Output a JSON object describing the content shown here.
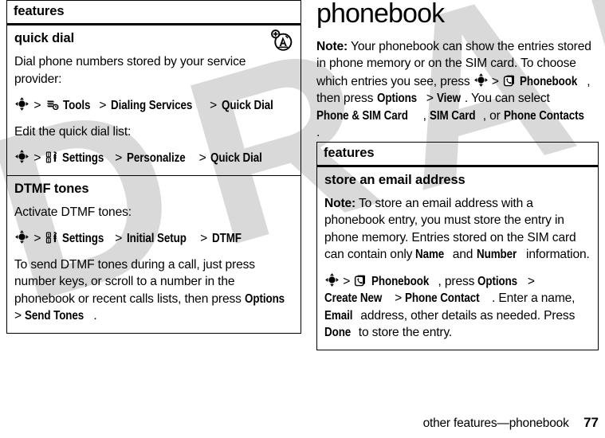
{
  "document": {
    "chapter_title": "phonebook",
    "footer": {
      "label": "other features—phonebook",
      "page_number": "77"
    },
    "watermark": "DRAFT"
  },
  "left_column": {
    "table": {
      "header": "features",
      "sections": [
        {
          "title": "quick dial",
          "corner_icon": "network-provider-icon",
          "blocks": [
            {
              "type": "paragraph",
              "text": "Dial phone numbers stored by your service provider:"
            },
            {
              "type": "path",
              "nav_icon": "navigation-key-icon",
              "items": [
                {
                  "icon": "tools-icon",
                  "label": "Tools"
                },
                {
                  "icon": null,
                  "label": "Dialing Services"
                },
                {
                  "icon": null,
                  "label": "Quick Dial"
                }
              ]
            },
            {
              "type": "paragraph",
              "text": "Edit the quick dial list:"
            },
            {
              "type": "path",
              "nav_icon": "navigation-key-icon",
              "items": [
                {
                  "icon": "settings-icon",
                  "label": "Settings"
                },
                {
                  "icon": null,
                  "label": "Personalize"
                },
                {
                  "icon": null,
                  "label": "Quick Dial"
                }
              ]
            }
          ]
        },
        {
          "title": "DTMF tones",
          "corner_icon": null,
          "blocks": [
            {
              "type": "paragraph",
              "text": "Activate DTMF tones:"
            },
            {
              "type": "path",
              "nav_icon": "navigation-key-icon",
              "items": [
                {
                  "icon": "settings-icon",
                  "label": "Settings"
                },
                {
                  "icon": null,
                  "label": "Initial Setup"
                },
                {
                  "icon": null,
                  "label": "DTMF"
                }
              ]
            },
            {
              "type": "rich",
              "runs": [
                {
                  "t": "To send DTMF tones during a call, just press number keys, or scroll to a number in the phonebook or recent calls lists, then press ",
                  "s": "plain"
                },
                {
                  "t": "Options",
                  "s": "ui"
                },
                {
                  "t": " > ",
                  "s": "plain"
                },
                {
                  "t": "Send Tones",
                  "s": "ui"
                },
                {
                  "t": ".",
                  "s": "plain"
                }
              ]
            }
          ]
        }
      ]
    }
  },
  "right_column": {
    "intro_note": {
      "label": "Note:",
      "runs": [
        {
          "t": "Note:",
          "s": "bold"
        },
        {
          "t": " Your phonebook can show the entries stored in phone memory or on the SIM card. To choose which entries you see, press ",
          "s": "plain"
        },
        {
          "t": "NAV",
          "s": "navicon"
        },
        {
          "t": " > ",
          "s": "plain"
        },
        {
          "t": "PHONEBOOK_ICON",
          "s": "phonebookicon"
        },
        {
          "t": "Phonebook",
          "s": "ui"
        },
        {
          "t": ", then press ",
          "s": "plain"
        },
        {
          "t": "Options",
          "s": "ui"
        },
        {
          "t": " > ",
          "s": "plain"
        },
        {
          "t": "View",
          "s": "ui"
        },
        {
          "t": ". You can select ",
          "s": "plain"
        },
        {
          "t": "Phone & SIM Card",
          "s": "ui"
        },
        {
          "t": ", ",
          "s": "plain"
        },
        {
          "t": "SIM Card",
          "s": "ui"
        },
        {
          "t": ", or ",
          "s": "plain"
        },
        {
          "t": "Phone Contacts",
          "s": "ui"
        },
        {
          "t": ".",
          "s": "plain"
        }
      ]
    },
    "table": {
      "header": "features",
      "sections": [
        {
          "title": "store an email address",
          "corner_icon": null,
          "blocks": [
            {
              "type": "rich",
              "runs": [
                {
                  "t": "Note:",
                  "s": "bold"
                },
                {
                  "t": " To store an email address with a phonebook entry, you must store the entry in phone memory. Entries stored on the SIM card can contain only ",
                  "s": "plain"
                },
                {
                  "t": "Name",
                  "s": "ui"
                },
                {
                  "t": " and ",
                  "s": "plain"
                },
                {
                  "t": "Number",
                  "s": "ui"
                },
                {
                  "t": " information.",
                  "s": "plain"
                }
              ]
            },
            {
              "type": "rich",
              "runs": [
                {
                  "t": "NAV",
                  "s": "navicon"
                },
                {
                  "t": " > ",
                  "s": "plain"
                },
                {
                  "t": "PHONEBOOK_ICON",
                  "s": "phonebookicon"
                },
                {
                  "t": "Phonebook",
                  "s": "ui"
                },
                {
                  "t": ", press ",
                  "s": "plain"
                },
                {
                  "t": "Options",
                  "s": "ui"
                },
                {
                  "t": " > ",
                  "s": "plain"
                },
                {
                  "t": "Create New",
                  "s": "ui"
                },
                {
                  "t": " > ",
                  "s": "plain"
                },
                {
                  "t": "Phone Contact",
                  "s": "ui"
                },
                {
                  "t": ". Enter a name, ",
                  "s": "plain"
                },
                {
                  "t": "Email",
                  "s": "ui"
                },
                {
                  "t": " address, other details as needed. Press ",
                  "s": "plain"
                },
                {
                  "t": "Done",
                  "s": "ui"
                },
                {
                  "t": " to store the entry.",
                  "s": "plain"
                }
              ]
            }
          ]
        }
      ]
    }
  },
  "colors": {
    "ink": "#000000",
    "paper": "#ffffff",
    "watermark": "#d9d9d9"
  }
}
